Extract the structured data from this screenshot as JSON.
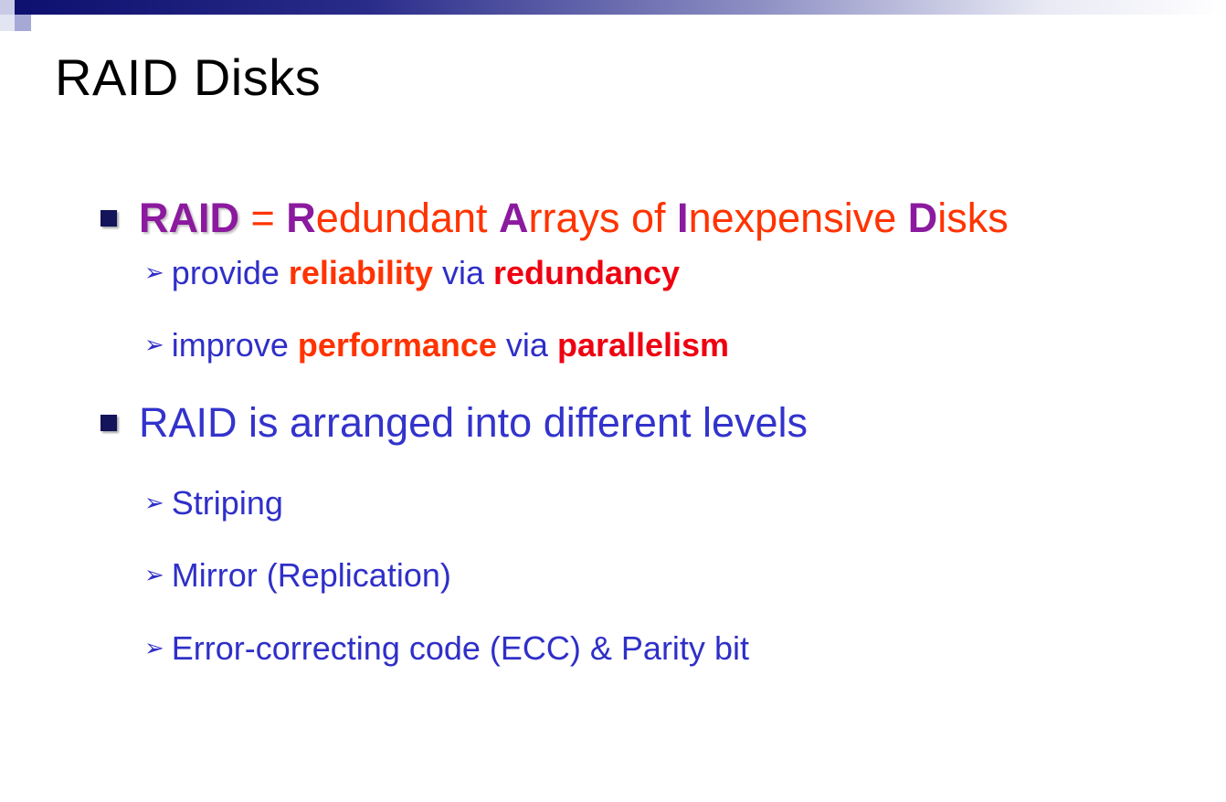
{
  "slide": {
    "title": "RAID Disks",
    "bullet1": {
      "raid": "RAID",
      "equals": " = ",
      "parts": [
        {
          "cap": "R",
          "rest": "edundant "
        },
        {
          "cap": "A",
          "rest": "rrays of "
        },
        {
          "cap": "I",
          "rest": "nexpensive "
        },
        {
          "cap": "D",
          "rest": "isks"
        }
      ],
      "subs": [
        {
          "pre": "provide ",
          "kw1": "reliability",
          "mid": " via ",
          "kw2": "redundancy"
        },
        {
          "pre": "improve ",
          "kw1": "performance",
          "mid": " via ",
          "kw2": "parallelism"
        }
      ]
    },
    "bullet2": {
      "text": "RAID is arranged into different levels",
      "subs": [
        "Striping",
        "Mirror (Replication)",
        "Error-correcting code (ECC) & Parity bit"
      ]
    },
    "sub_marker": "➢",
    "colors": {
      "accent_blue": "#3333cc",
      "raid_purple": "#8b1a9e",
      "orange_red": "#ff3300",
      "red": "#ee0011"
    }
  }
}
